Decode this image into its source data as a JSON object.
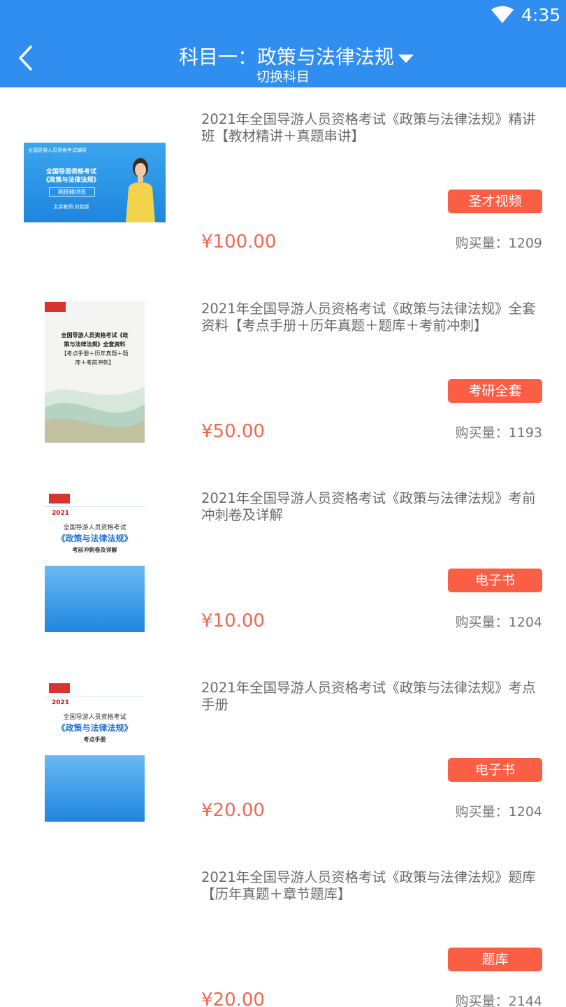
{
  "status_bar": {
    "time": "4:35"
  },
  "header": {
    "title": "科目一：政策与法律法规",
    "switch_label": "切换科目"
  },
  "colors": {
    "accent": "#2f8ef0",
    "tag": "#fa5f46",
    "price": "#f3674f"
  },
  "products": [
    {
      "title": "2021年全国导游人员资格考试《政策与法律法规》精讲班【教材精讲＋真题串讲】",
      "tag": "圣才视频",
      "price": "¥100.00",
      "sales": "购买量：1209",
      "cover": {
        "type": "video",
        "banner": "全国导游人员资格考试辅导",
        "line1": "全国导游资格考试",
        "line2": "《政策与法律法规》",
        "box": "网授精讲班",
        "teacher": "主讲教师:刘若姬"
      }
    },
    {
      "title": "2021年全国导游人员资格考试《政策与法律法规》全套资料【考点手册＋历年真题＋题库＋考前冲刺】",
      "tag": "考研全套",
      "price": "¥50.00",
      "sales": "购买量：1193",
      "cover": {
        "type": "book",
        "l1": "全国导游人员资格考试《政",
        "l2": "策与法律法规》全套资料",
        "l3": "【考点手册＋历年真题＋题",
        "l4": "库＋考前冲刺】"
      }
    },
    {
      "title": "2021年全国导游人员资格考试《政策与法律法规》考前冲刺卷及详解",
      "tag": "电子书",
      "price": "¥10.00",
      "sales": "购买量：1204",
      "cover": {
        "type": "blue",
        "year": "2021",
        "l1": "全国导游人员资格考试",
        "l2": "《政策与法律法规》",
        "l3": "考前冲刺卷及详解"
      }
    },
    {
      "title": "2021年全国导游人员资格考试《政策与法律法规》考点手册",
      "tag": "电子书",
      "price": "¥20.00",
      "sales": "购买量：1204",
      "cover": {
        "type": "blue",
        "year": "2021",
        "l1": "全国导游人员资格考试",
        "l2": "《政策与法律法规》",
        "l3": "考点手册"
      }
    },
    {
      "title": "2021年全国导游人员资格考试《政策与法律法规》题库【历年真题＋章节题库】",
      "tag": "题库",
      "price": "¥20.00",
      "sales": "购买量：2144",
      "cover": {
        "type": "none"
      }
    }
  ]
}
